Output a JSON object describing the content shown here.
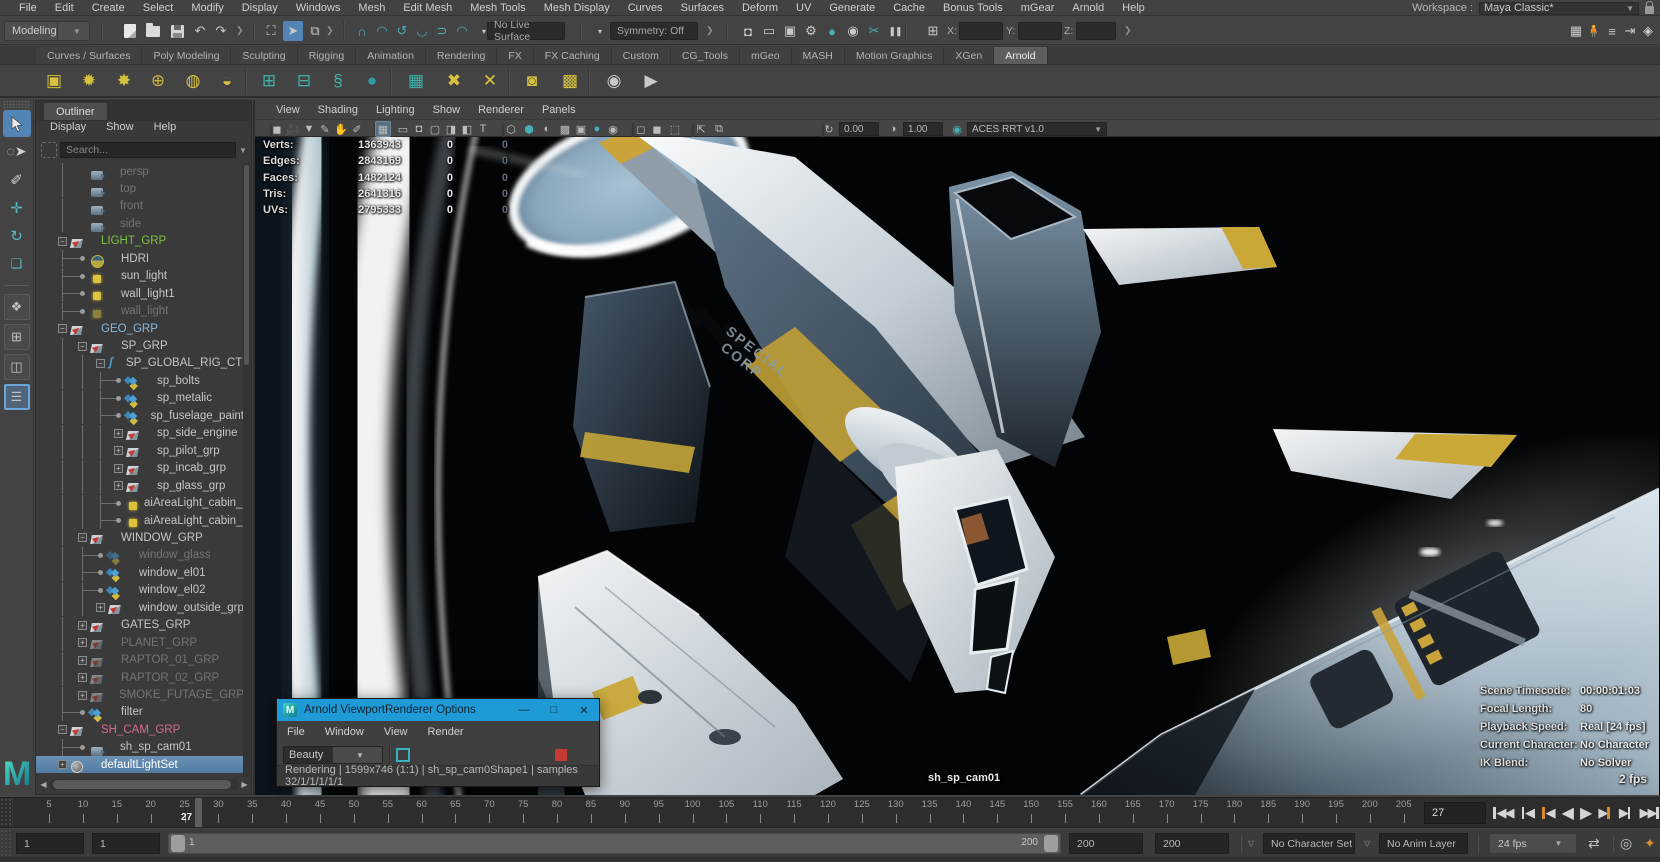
{
  "menubar": {
    "items": [
      "File",
      "Edit",
      "Create",
      "Select",
      "Modify",
      "Display",
      "Windows",
      "Mesh",
      "Edit Mesh",
      "Mesh Tools",
      "Mesh Display",
      "Curves",
      "Surfaces",
      "Deform",
      "UV",
      "Generate",
      "Cache",
      "Bonus Tools",
      "mGear",
      "Arnold",
      "Help"
    ],
    "workspace_label": "Workspace :",
    "workspace_value": "Maya Classic*"
  },
  "toolbar": {
    "mode": "Modeling",
    "no_live_surface": "No Live Surface",
    "symmetry": "Symmetry: Off",
    "axis_labels": [
      "X:",
      "Y:",
      "Z:"
    ],
    "icons_file": [
      "new-scene",
      "open-scene",
      "save-scene",
      "undo",
      "redo"
    ],
    "icons_select": [
      "select-by-hierarchy",
      "select-by-object",
      "select-by-component"
    ],
    "icons_snap": [
      "snap-grid",
      "snap-curve",
      "snap-point",
      "snap-projected-center",
      "snap-view-plane",
      "make-live"
    ],
    "icons_render": [
      "render-view",
      "render-current-frame",
      "ipr-render",
      "render-settings",
      "hypershade",
      "arnold-render",
      "paint-effects",
      "pause-viewport"
    ],
    "icons_right": [
      "modeling-toolkit",
      "character-controls",
      "attribute-spreadsheet",
      "channel-box",
      "sculpting"
    ]
  },
  "shelf": {
    "tabs": [
      "Curves / Surfaces",
      "Poly Modeling",
      "Sculpting",
      "Rigging",
      "Animation",
      "Rendering",
      "FX",
      "FX Caching",
      "Custom",
      "CG_Tools",
      "mGeo",
      "MASH",
      "Motion Graphics",
      "XGen",
      "Arnold"
    ],
    "active_tab": "Arnold",
    "icons": [
      "area-light",
      "point-light",
      "spot-light",
      "skydome-light",
      "mesh-light",
      "photometric-light",
      "standin-create",
      "standin-export",
      "curve-collector",
      "procedural",
      "tx-manager",
      "convert-textures",
      "delete-tx",
      "light-filter-gobo",
      "light-filter-blocker",
      "render-still",
      "render-sequence"
    ]
  },
  "toolbox": {
    "tools": [
      "select-tool",
      "lasso-tool",
      "paint-select-tool",
      "move-tool",
      "rotate-tool",
      "scale-tool"
    ],
    "layouts": [
      "single-pane-layout",
      "four-pane-layout",
      "two-pane-layout",
      "outliner-persp-layout"
    ]
  },
  "outliner": {
    "title": "Outliner",
    "menus": [
      "Display",
      "Show",
      "Help"
    ],
    "search_placeholder": "Search...",
    "items": [
      {
        "label": "persp",
        "depth": 1,
        "icon": "camera",
        "prefix": "none",
        "style": "dim"
      },
      {
        "label": "top",
        "depth": 1,
        "icon": "camera",
        "prefix": "none",
        "style": "dim"
      },
      {
        "label": "front",
        "depth": 1,
        "icon": "camera",
        "prefix": "none",
        "style": "dim"
      },
      {
        "label": "side",
        "depth": 1,
        "icon": "camera",
        "prefix": "none",
        "style": "dim"
      },
      {
        "label": "LIGHT_GRP",
        "depth": 0,
        "icon": "group",
        "prefix": "minus",
        "style": "green"
      },
      {
        "label": "HDRI",
        "depth": 1,
        "icon": "skydome",
        "prefix": "dot",
        "style": "normal"
      },
      {
        "label": "sun_light",
        "depth": 1,
        "icon": "light",
        "prefix": "dot",
        "style": "normal"
      },
      {
        "label": "wall_light1",
        "depth": 1,
        "icon": "light",
        "prefix": "dot",
        "style": "normal"
      },
      {
        "label": "wall_light",
        "depth": 1,
        "icon": "light",
        "prefix": "dot",
        "style": "dim"
      },
      {
        "label": "GEO_GRP",
        "depth": 0,
        "icon": "group",
        "prefix": "minus",
        "style": "blue"
      },
      {
        "label": "SP_GRP",
        "depth": 1,
        "icon": "group",
        "prefix": "minus",
        "style": "normal"
      },
      {
        "label": "SP_GLOBAL_RIG_CTRL",
        "depth": 2,
        "icon": "curve",
        "prefix": "minus",
        "style": "normal"
      },
      {
        "label": "sp_bolts",
        "depth": 3,
        "icon": "mesh",
        "prefix": "dot",
        "style": "normal"
      },
      {
        "label": "sp_metalic",
        "depth": 3,
        "icon": "mesh",
        "prefix": "dot",
        "style": "normal"
      },
      {
        "label": "sp_fuselage_paint",
        "depth": 3,
        "icon": "mesh",
        "prefix": "dot",
        "style": "normal"
      },
      {
        "label": "sp_side_engine",
        "depth": 3,
        "icon": "group",
        "prefix": "plus",
        "style": "normal"
      },
      {
        "label": "sp_pilot_grp",
        "depth": 3,
        "icon": "group",
        "prefix": "plus",
        "style": "normal"
      },
      {
        "label": "sp_incab_grp",
        "depth": 3,
        "icon": "group",
        "prefix": "plus",
        "style": "normal"
      },
      {
        "label": "sp_glass_grp",
        "depth": 3,
        "icon": "group",
        "prefix": "plus",
        "style": "normal"
      },
      {
        "label": "aiAreaLight_cabin_red",
        "depth": 3,
        "icon": "light",
        "prefix": "dot",
        "style": "normal"
      },
      {
        "label": "aiAreaLight_cabin_blue",
        "depth": 3,
        "icon": "light",
        "prefix": "dot",
        "style": "normal"
      },
      {
        "label": "WINDOW_GRP",
        "depth": 1,
        "icon": "group",
        "prefix": "minus",
        "style": "normal"
      },
      {
        "label": "window_glass",
        "depth": 2,
        "icon": "mesh",
        "prefix": "dot",
        "style": "dim"
      },
      {
        "label": "window_el01",
        "depth": 2,
        "icon": "mesh",
        "prefix": "dot",
        "style": "normal"
      },
      {
        "label": "window_el02",
        "depth": 2,
        "icon": "mesh",
        "prefix": "dot",
        "style": "normal"
      },
      {
        "label": "window_outside_grp",
        "depth": 2,
        "icon": "group",
        "prefix": "plus",
        "style": "normal"
      },
      {
        "label": "GATES_GRP",
        "depth": 1,
        "icon": "group",
        "prefix": "plus",
        "style": "normal"
      },
      {
        "label": "PLANET_GRP",
        "depth": 1,
        "icon": "group",
        "prefix": "plus",
        "style": "dim"
      },
      {
        "label": "RAPTOR_01_GRP",
        "depth": 1,
        "icon": "group",
        "prefix": "plus",
        "style": "dim"
      },
      {
        "label": "RAPTOR_02_GRP",
        "depth": 1,
        "icon": "group",
        "prefix": "plus",
        "style": "dim"
      },
      {
        "label": "SMOKE_FUTAGE_GRP",
        "depth": 1,
        "icon": "group",
        "prefix": "plus",
        "style": "dim"
      },
      {
        "label": "filter",
        "depth": 1,
        "icon": "mesh",
        "prefix": "dot",
        "style": "normal"
      },
      {
        "label": "SH_CAM_GRP",
        "depth": 0,
        "icon": "group",
        "prefix": "minus",
        "style": "pink"
      },
      {
        "label": "sh_sp_cam01",
        "depth": 1,
        "icon": "camera",
        "prefix": "dot",
        "style": "normal"
      },
      {
        "label": "defaultLightSet",
        "depth": 0,
        "icon": "set",
        "prefix": "plus",
        "style": "white",
        "selected": true
      }
    ]
  },
  "viewport": {
    "menus": [
      "View",
      "Shading",
      "Lighting",
      "Show",
      "Renderer",
      "Panels"
    ],
    "exposure": "0.00",
    "gamma": "1.00",
    "view_transform": "ACES RRT v1.0",
    "hud_rows": [
      {
        "label": "Verts:",
        "v1": "1363943",
        "v2": "0",
        "v3": "0"
      },
      {
        "label": "Edges:",
        "v1": "2843169",
        "v2": "0",
        "v3": "0"
      },
      {
        "label": "Faces:",
        "v1": "1482124",
        "v2": "0",
        "v3": "0"
      },
      {
        "label": "Tris:",
        "v1": "2641316",
        "v2": "0",
        "v3": "0"
      },
      {
        "label": "UVs:",
        "v1": "2795333",
        "v2": "0",
        "v3": "0"
      }
    ],
    "camera_label": "sh_sp_cam01",
    "stats": [
      {
        "label": "Scene Timecode:",
        "value": "00:00:01:03"
      },
      {
        "label": "Focal Length:",
        "value": "80"
      },
      {
        "label": "Playback Speed:",
        "value": "Real [24 fps]"
      },
      {
        "label": "Current Character:",
        "value": "No Character"
      },
      {
        "label": "IK Blend:",
        "value": "No Solver"
      }
    ],
    "fps_overlay": "2 fps",
    "ship_text_line1": "SPECIAL",
    "ship_text_line2": "CORP"
  },
  "arnold_window": {
    "title": "Arnold ViewportRenderer Options",
    "menus": [
      "File",
      "Window",
      "View",
      "Render"
    ],
    "aov": "Beauty",
    "status": "Rendering | 1599x746 (1:1) | sh_sp_cam0Shape1  | samples 32/1/1/1/1/1"
  },
  "timeline": {
    "labels": [
      5,
      10,
      15,
      20,
      25,
      30,
      35,
      40,
      45,
      50,
      55,
      60,
      65,
      70,
      75,
      80,
      85,
      90,
      95,
      100,
      105,
      110,
      115,
      120,
      125,
      130,
      135,
      140,
      145,
      150,
      155,
      160,
      165,
      170,
      175,
      180,
      185,
      190,
      195,
      200,
      205
    ],
    "start": 1,
    "end": 205,
    "current": "27",
    "playback": [
      "go-to-start",
      "step-back-frame",
      "step-back-key",
      "play-backwards",
      "play-forwards",
      "step-forward-key",
      "step-forward-frame",
      "go-to-end"
    ]
  },
  "rangebar": {
    "anim_start": "1",
    "scene_start": "1",
    "slider_start": "1",
    "slider_end": "200",
    "scene_end": "200",
    "anim_end": "200",
    "character_set": "No Character Set",
    "anim_layer": "No Anim Layer",
    "fps": "24 fps"
  }
}
